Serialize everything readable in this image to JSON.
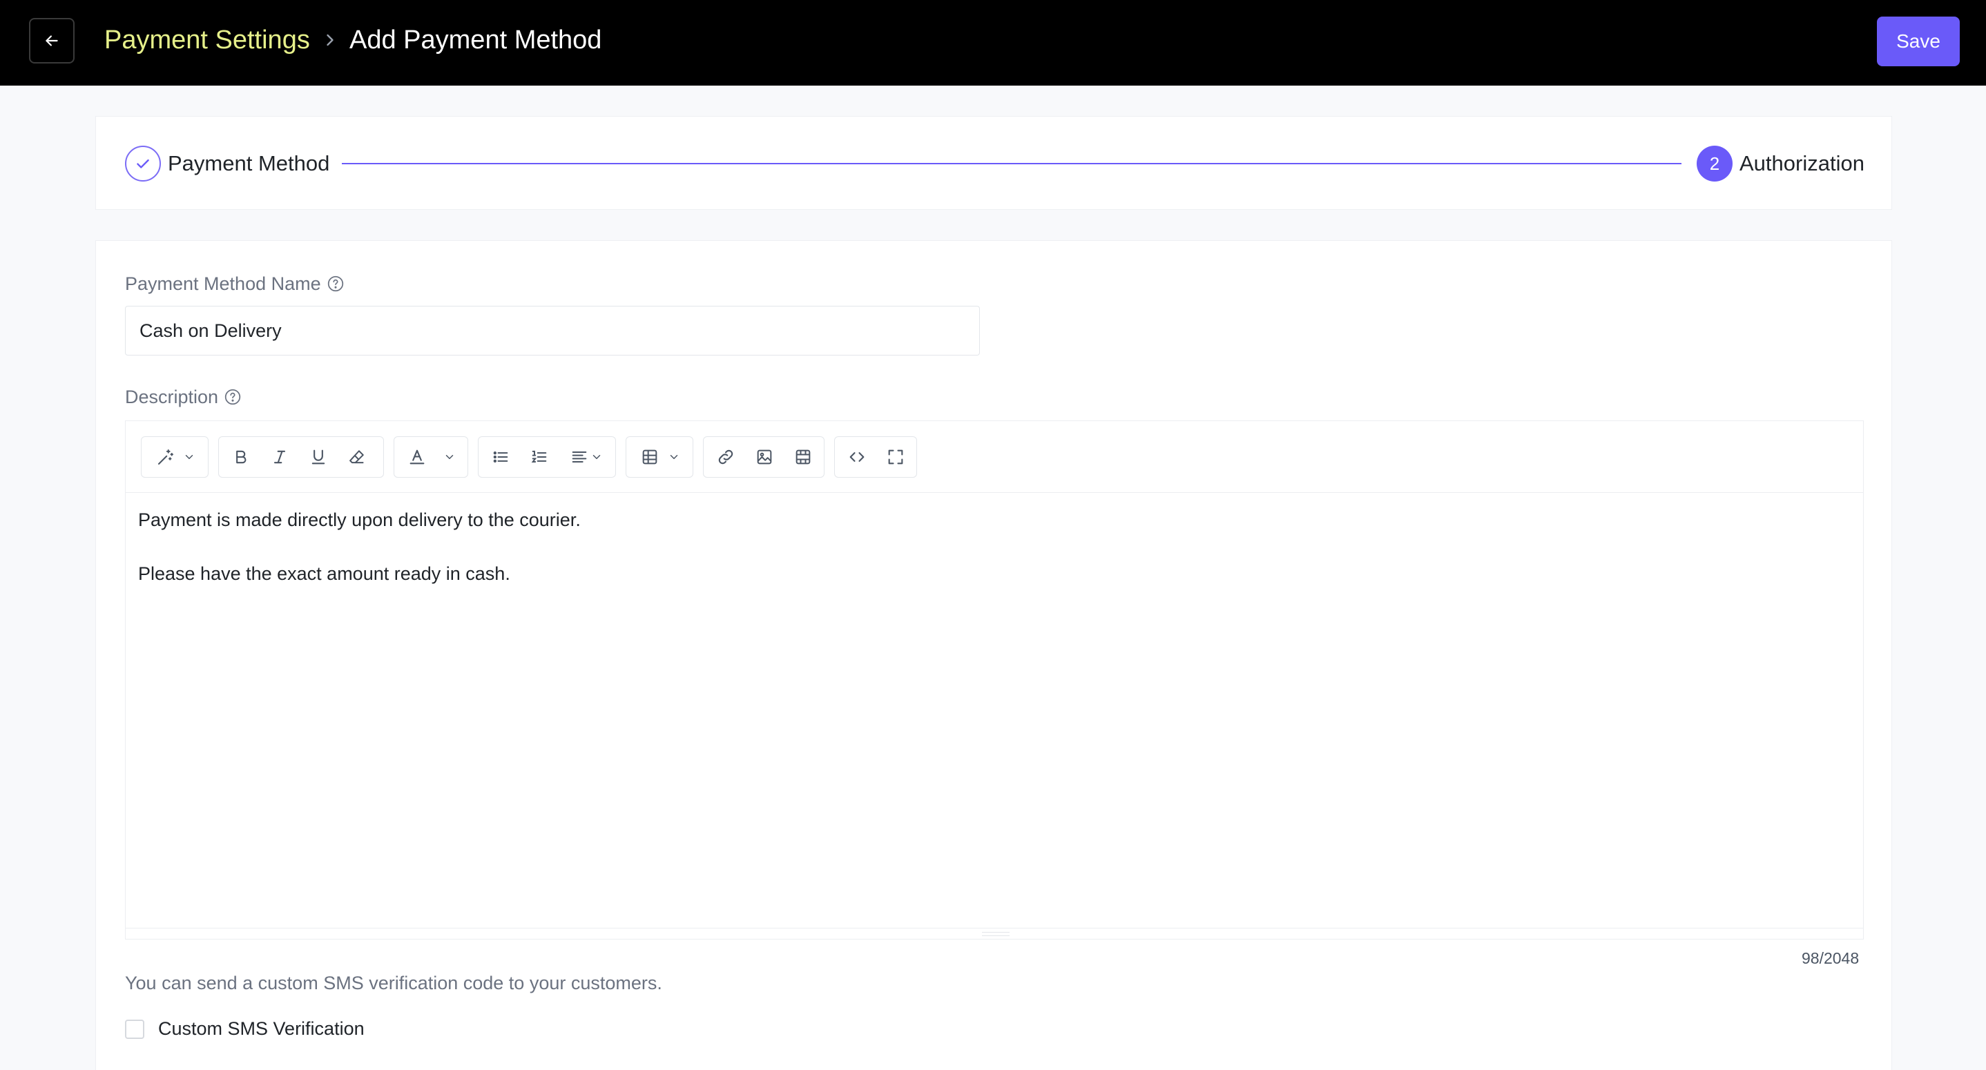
{
  "header": {
    "breadcrumb_parent": "Payment Settings",
    "breadcrumb_current": "Add Payment Method",
    "save_label": "Save"
  },
  "stepper": {
    "steps": [
      {
        "label": "Payment Method",
        "state": "completed",
        "icon": "check-icon"
      },
      {
        "label": "Authorization",
        "state": "current",
        "number": "2"
      }
    ]
  },
  "form": {
    "name_label": "Payment Method Name",
    "name_value": "Cash on Delivery",
    "description_label": "Description",
    "description_paragraphs": [
      "Payment is made directly upon delivery to the courier.",
      "Please have the exact amount ready in cash."
    ],
    "char_count": "98/2048",
    "sms_hint": "You can send a custom SMS verification code to your customers.",
    "sms_checkbox_label": "Custom SMS Verification",
    "sms_checked": false
  },
  "toolbar_icons": [
    "magic-wand-icon",
    "bold-icon",
    "italic-icon",
    "underline-icon",
    "eraser-icon",
    "font-color-icon",
    "bullet-list-icon",
    "numbered-list-icon",
    "align-icon",
    "table-icon",
    "link-icon",
    "image-icon",
    "video-icon",
    "code-view-icon",
    "fullscreen-icon"
  ],
  "colors": {
    "accent": "#6a5af9",
    "breadcrumb_parent": "#e6f08a",
    "topbar": "#000000"
  }
}
